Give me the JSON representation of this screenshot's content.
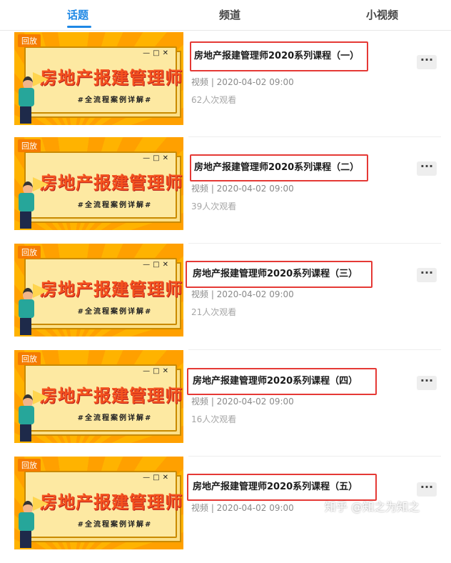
{
  "tabs": [
    {
      "label": "话题",
      "active": true
    },
    {
      "label": "频道",
      "active": false
    },
    {
      "label": "小视频",
      "active": false
    }
  ],
  "accent_color": "#1e88e5",
  "highlight_color": "#e53935",
  "thumbnail": {
    "badge": "回放",
    "headline": "房地产报建管理师",
    "subline": "#全流程案例详解#",
    "window_controls": "—□✕"
  },
  "items": [
    {
      "title": "房地产报建管理师2020系列课程（一）",
      "meta": "视频 |  2020-04-02 09:00",
      "views": "62人次观看",
      "more_label": "···"
    },
    {
      "title": "房地产报建管理师2020系列课程（二）",
      "meta": "视频 |  2020-04-02 09:00",
      "views": "39人次观看",
      "more_label": "···"
    },
    {
      "title": "房地产报建管理师2020系列课程（三）",
      "meta": "视频 |  2020-04-02 09:00",
      "views": "21人次观看",
      "more_label": "···"
    },
    {
      "title": "房地产报建管理师2020系列课程（四）",
      "meta": "视频 |  2020-04-02 09:00",
      "views": "16人次观看",
      "more_label": "···"
    },
    {
      "title": "房地产报建管理师2020系列课程（五）",
      "meta": "视频 |  2020-04-02 09:00",
      "views": "",
      "more_label": "···"
    }
  ],
  "watermark": "知乎 @知之为知之"
}
